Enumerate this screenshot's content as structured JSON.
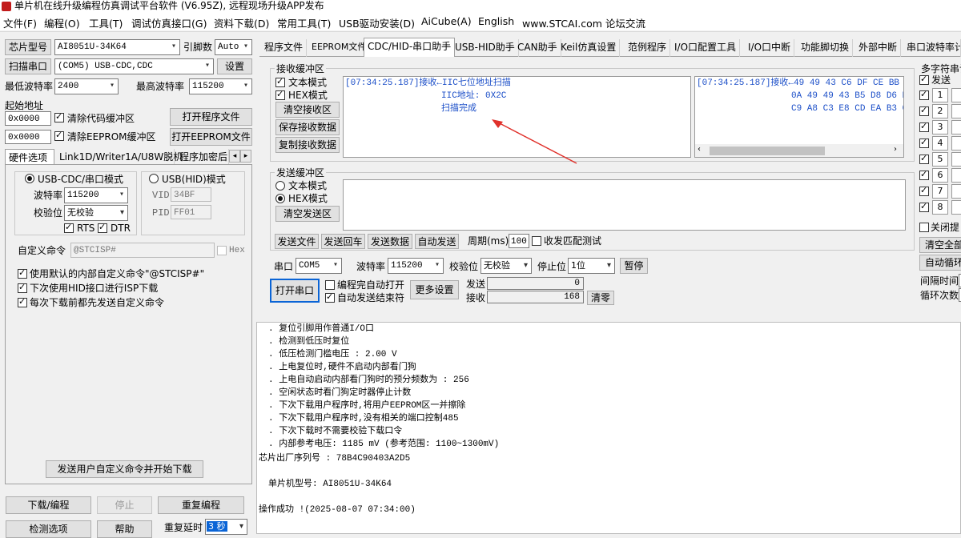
{
  "title_bar": {
    "title": "单片机在线升级编程仿真调试平台软件 (V6.95Z), 远程现场升级APP发布"
  },
  "menu": [
    "文件(F)",
    "编程(O)",
    "工具(T)",
    "调试仿真接口(G)",
    "资料下载(D)",
    "常用工具(T)",
    "USB驱动安装(D)",
    "AiCube(A)",
    "English",
    "www.STCAI.com 论坛交流"
  ],
  "left": {
    "chip_type_label": "芯片型号",
    "chip_type_value": "AI8051U-34K64",
    "pin_count_label": "引脚数",
    "pin_count_value": "Auto",
    "scan_port_label": "扫描串口",
    "port_value": "(COM5) USB-CDC,CDC",
    "settings_label": "设置",
    "min_baud_label": "最低波特率",
    "min_baud_value": "2400",
    "max_baud_label": "最高波特率",
    "max_baud_value": "115200",
    "start_addr_label": "起始地址",
    "addr1": "0x0000",
    "clear_code_label": "清除代码缓冲区",
    "open_program_label": "打开程序文件",
    "addr2": "0x0000",
    "clear_eeprom_label": "清除EEPROM缓冲区",
    "open_eeprom_label": "打开EEPROM文件",
    "tabs": [
      "硬件选项",
      "Link1D/Writer1A/U8W脱机",
      "程序加密后"
    ],
    "usb_cdc_mode": "USB-CDC/串口模式",
    "usb_hid_mode": "USB(HID)模式",
    "baud_label": "波特率",
    "baud_value": "115200",
    "parity_label": "校验位",
    "parity_value": "无校验",
    "rts_label": "RTS",
    "dtr_label": "DTR",
    "vid_label": "VID",
    "vid_value": "34BF",
    "pid_label": "PID",
    "pid_value": "FF01",
    "custom_cmd_label": "自定义命令",
    "custom_cmd_value": "@STCISP#",
    "hex_label": "Hex",
    "opt1": "使用默认的内部自定义命令\"@STCISP#\"",
    "opt2": "下次使用HID接口进行ISP下载",
    "opt3": "每次下载前都先发送自定义命令",
    "send_custom_btn": "发送用户自定义命令并开始下载",
    "download_btn": "下载/编程",
    "stop_btn": "停止",
    "reprogram_btn": "重复编程",
    "check_opts_btn": "检测选项",
    "help_btn": "帮助",
    "repeat_delay_label": "重复延时",
    "repeat_delay_value": "3 秒"
  },
  "right_tabs": [
    "程序文件",
    "EEPROM文件",
    "CDC/HID-串口助手",
    "USB-HID助手",
    "CAN助手",
    "Keil仿真设置",
    "范例程序",
    "I/O口配置工具",
    "I/O口中断",
    "功能脚切换",
    "外部中断",
    "串口波特率计"
  ],
  "recv": {
    "group_label": "接收缓冲区",
    "text_mode": "文本模式",
    "hex_mode": "HEX模式",
    "clear_btn": "清空接收区",
    "save_btn": "保存接收数据",
    "copy_btn": "复制接收数据",
    "text_lines": [
      "[07:34:25.187]接收←IIC七位地址扫描",
      "IIC地址: 0X2C",
      "扫描完成"
    ],
    "hex_lines": [
      "[07:34:25.187]接收←49 49 43 C6 DF CE BB B5",
      "0A 49 49 43 B5 D8 D6 B7",
      "C9 A8 C3 E8 CD EA B3 C9"
    ]
  },
  "send": {
    "group_label": "发送缓冲区",
    "text_mode": "文本模式",
    "hex_mode": "HEX模式",
    "clear_btn": "清空发送区",
    "send_file_btn": "发送文件",
    "send_return_btn": "发送回车",
    "send_data_btn": "发送数据",
    "auto_send_btn": "自动发送",
    "period_label": "周期(ms)",
    "period_value": "100",
    "match_label": "收发匹配测试"
  },
  "serial": {
    "port_label": "串口",
    "port_value": "COM5",
    "baud_label": "波特率",
    "baud_value": "115200",
    "parity_label": "校验位",
    "parity_value": "无校验",
    "stop_label": "停止位",
    "stop_value": "1位",
    "pause_btn": "暂停",
    "open_btn": "打开串口",
    "auto_open_label": "编程完自动打开",
    "auto_clear_label": "自动发送结束符",
    "more_btn": "更多设置",
    "send_label": "发送",
    "send_count": "0",
    "recv_label": "接收",
    "recv_count": "168",
    "clear_btn": "清零"
  },
  "multi": {
    "title": "多字符串计",
    "send_label": "发送",
    "rows": [
      "1",
      "2",
      "3",
      "4",
      "5",
      "6",
      "7",
      "8"
    ],
    "close_prompt": "关闭提",
    "clear_all": "清空全部",
    "auto_loop": "自动循环",
    "interval_label": "间隔时间",
    "loop_count": "循环次数"
  },
  "log": {
    "lines": [
      ". 复位引脚用作普通I/O口",
      ". 检测到低压时复位",
      ". 低压检测门槛电压 : 2.00 V",
      ". 上电复位时,硬件不启动内部看门狗",
      ". 上电自动启动内部看门狗时的预分频数为 : 256",
      ". 空闲状态时看门狗定时器停止计数",
      ". 下次下载用户程序时,将用户EEPROM区一并擦除",
      ". 下次下载用户程序时,没有相关的端口控制485",
      ". 下次下载时不需要校验下载口令",
      ". 内部参考电压: 1185 mV (参考范围: 1100~1300mV)"
    ],
    "serial_line": "芯片出厂序列号 : 78B4C90403A2D5",
    "model_line": "单片机型号: AI8051U-34K64",
    "success_line": "操作成功 !(2025-08-07 07:34:00)"
  },
  "colors": {
    "accent_blue": "#1c4fc8",
    "arrow_red": "#e0312b"
  }
}
